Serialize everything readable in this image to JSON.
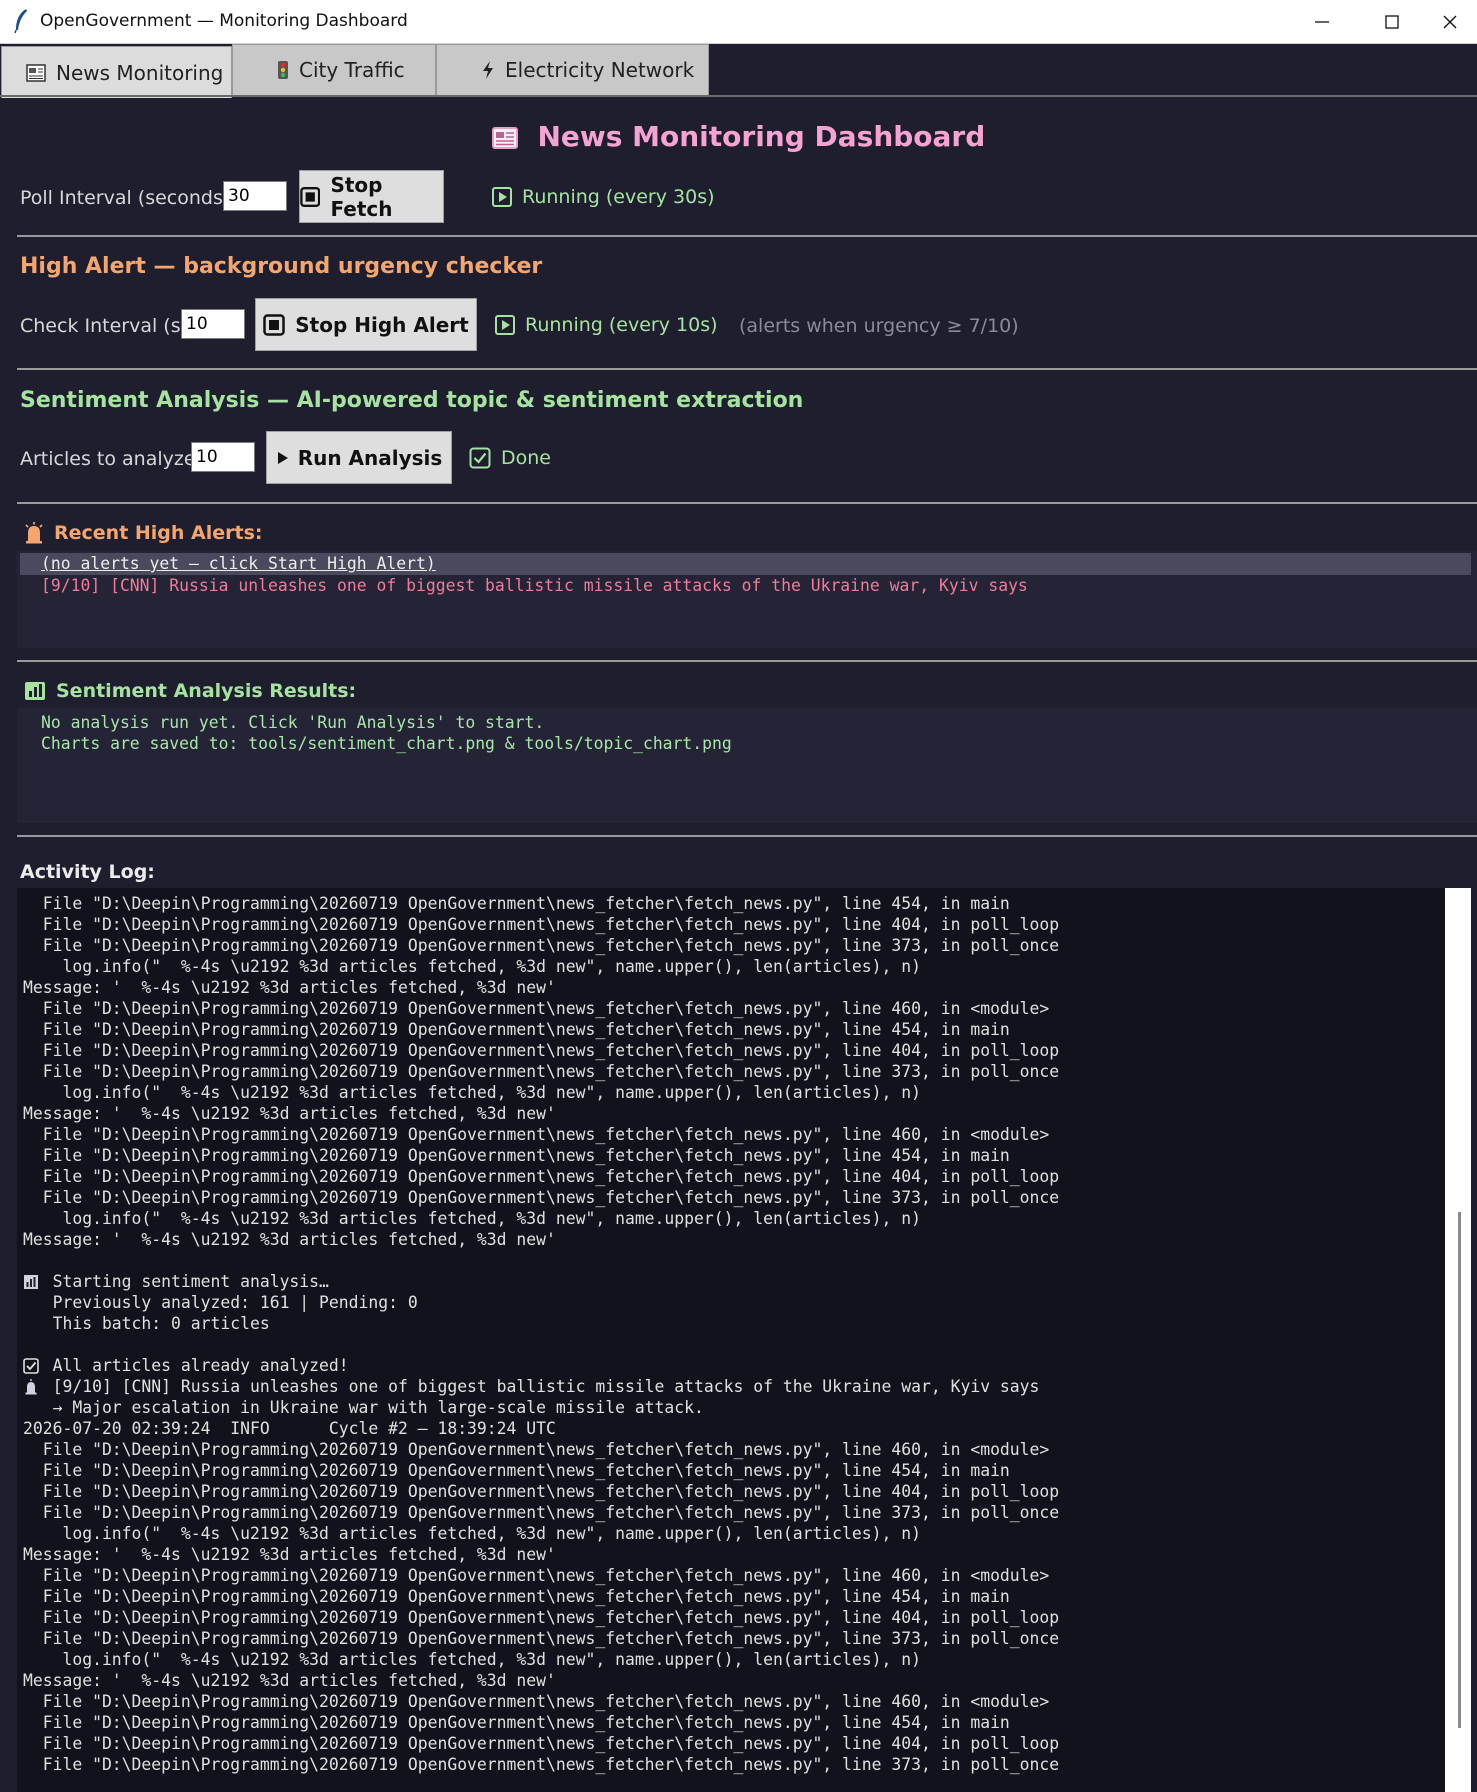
{
  "window": {
    "title": "OpenGovernment — Monitoring Dashboard",
    "controls": [
      "minimize",
      "maximize",
      "close"
    ]
  },
  "tabs": [
    {
      "label": "News Monitoring",
      "icon": "newspaper-icon",
      "active": true
    },
    {
      "label": "City Traffic",
      "icon": "traffic-light-icon",
      "active": false
    },
    {
      "label": "Electricity Network",
      "icon": "lightning-icon",
      "active": false
    }
  ],
  "header": {
    "title": "News Monitoring Dashboard",
    "icon": "newspaper-icon"
  },
  "fetch": {
    "label": "Poll Interval (seconds):",
    "value": "30",
    "button": "Stop Fetch",
    "status": "Running (every 30s)"
  },
  "high_alert": {
    "title": "High Alert — background urgency checker",
    "label": "Check Interval (s):",
    "value": "10",
    "button": "Stop High Alert",
    "status": "Running (every 10s)",
    "note": "(alerts when urgency ≥ 7/10)"
  },
  "sentiment": {
    "title": "Sentiment Analysis — AI-powered topic & sentiment extraction",
    "label": "Articles to analyze:",
    "value": "10",
    "button": "Run Analysis",
    "status": "Done"
  },
  "recent_alerts": {
    "title": "Recent High Alerts:",
    "items": [
      "(no alerts yet — click Start High Alert)",
      "[9/10] [CNN] Russia unleashes one of biggest ballistic missile attacks of the Ukraine war, Kyiv says"
    ]
  },
  "results": {
    "title": "Sentiment Analysis Results:",
    "lines": [
      "No analysis run yet. Click 'Run Analysis' to start.",
      "Charts are saved to: tools/sentiment_chart.png & tools/topic_chart.png"
    ]
  },
  "activity_log": {
    "title": "Activity Log:",
    "lines": [
      "  File \"D:\\Deepin\\Programming\\20260719 OpenGovernment\\news_fetcher\\fetch_news.py\", line 454, in main",
      "  File \"D:\\Deepin\\Programming\\20260719 OpenGovernment\\news_fetcher\\fetch_news.py\", line 404, in poll_loop",
      "  File \"D:\\Deepin\\Programming\\20260719 OpenGovernment\\news_fetcher\\fetch_news.py\", line 373, in poll_once",
      "    log.info(\"  %-4s \\u2192 %3d articles fetched, %3d new\", name.upper(), len(articles), n)",
      "Message: '  %-4s \\u2192 %3d articles fetched, %3d new'",
      "  File \"D:\\Deepin\\Programming\\20260719 OpenGovernment\\news_fetcher\\fetch_news.py\", line 460, in <module>",
      "  File \"D:\\Deepin\\Programming\\20260719 OpenGovernment\\news_fetcher\\fetch_news.py\", line 454, in main",
      "  File \"D:\\Deepin\\Programming\\20260719 OpenGovernment\\news_fetcher\\fetch_news.py\", line 404, in poll_loop",
      "  File \"D:\\Deepin\\Programming\\20260719 OpenGovernment\\news_fetcher\\fetch_news.py\", line 373, in poll_once",
      "    log.info(\"  %-4s \\u2192 %3d articles fetched, %3d new\", name.upper(), len(articles), n)",
      "Message: '  %-4s \\u2192 %3d articles fetched, %3d new'",
      "  File \"D:\\Deepin\\Programming\\20260719 OpenGovernment\\news_fetcher\\fetch_news.py\", line 460, in <module>",
      "  File \"D:\\Deepin\\Programming\\20260719 OpenGovernment\\news_fetcher\\fetch_news.py\", line 454, in main",
      "  File \"D:\\Deepin\\Programming\\20260719 OpenGovernment\\news_fetcher\\fetch_news.py\", line 404, in poll_loop",
      "  File \"D:\\Deepin\\Programming\\20260719 OpenGovernment\\news_fetcher\\fetch_news.py\", line 373, in poll_once",
      "    log.info(\"  %-4s \\u2192 %3d articles fetched, %3d new\", name.upper(), len(articles), n)",
      "Message: '  %-4s \\u2192 %3d articles fetched, %3d new'",
      "",
      "   Starting sentiment analysis…",
      "   Previously analyzed: 161 | Pending: 0",
      "   This batch: 0 articles",
      "",
      "   All articles already analyzed!",
      "   [9/10] [CNN] Russia unleashes one of biggest ballistic missile attacks of the Ukraine war, Kyiv says",
      "   → Major escalation in Ukraine war with large-scale missile attack.",
      "2026-07-20 02:39:24  INFO      Cycle #2 — 18:39:24 UTC",
      "  File \"D:\\Deepin\\Programming\\20260719 OpenGovernment\\news_fetcher\\fetch_news.py\", line 460, in <module>",
      "  File \"D:\\Deepin\\Programming\\20260719 OpenGovernment\\news_fetcher\\fetch_news.py\", line 454, in main",
      "  File \"D:\\Deepin\\Programming\\20260719 OpenGovernment\\news_fetcher\\fetch_news.py\", line 404, in poll_loop",
      "  File \"D:\\Deepin\\Programming\\20260719 OpenGovernment\\news_fetcher\\fetch_news.py\", line 373, in poll_once",
      "    log.info(\"  %-4s \\u2192 %3d articles fetched, %3d new\", name.upper(), len(articles), n)",
      "Message: '  %-4s \\u2192 %3d articles fetched, %3d new'",
      "  File \"D:\\Deepin\\Programming\\20260719 OpenGovernment\\news_fetcher\\fetch_news.py\", line 460, in <module>",
      "  File \"D:\\Deepin\\Programming\\20260719 OpenGovernment\\news_fetcher\\fetch_news.py\", line 454, in main",
      "  File \"D:\\Deepin\\Programming\\20260719 OpenGovernment\\news_fetcher\\fetch_news.py\", line 404, in poll_loop",
      "  File \"D:\\Deepin\\Programming\\20260719 OpenGovernment\\news_fetcher\\fetch_news.py\", line 373, in poll_once",
      "    log.info(\"  %-4s \\u2192 %3d articles fetched, %3d new\", name.upper(), len(articles), n)",
      "Message: '  %-4s \\u2192 %3d articles fetched, %3d new'",
      "  File \"D:\\Deepin\\Programming\\20260719 OpenGovernment\\news_fetcher\\fetch_news.py\", line 460, in <module>",
      "  File \"D:\\Deepin\\Programming\\20260719 OpenGovernment\\news_fetcher\\fetch_news.py\", line 454, in main",
      "  File \"D:\\Deepin\\Programming\\20260719 OpenGovernment\\news_fetcher\\fetch_news.py\", line 404, in poll_loop",
      "  File \"D:\\Deepin\\Programming\\20260719 OpenGovernment\\news_fetcher\\fetch_news.py\", line 373, in poll_once"
    ],
    "line_icons": {
      "18": "chart-icon",
      "22": "checkbox-icon",
      "23": "alarm-icon"
    }
  },
  "colors": {
    "background": "#1e1e2e",
    "title_pink": "#f5a3d3",
    "high_alert_orange": "#f5a66e",
    "sentiment_green": "#a6e3a1",
    "status_green": "#a6e3a1",
    "alert_pink": "#f07b9a",
    "log_bg": "#12121c"
  }
}
